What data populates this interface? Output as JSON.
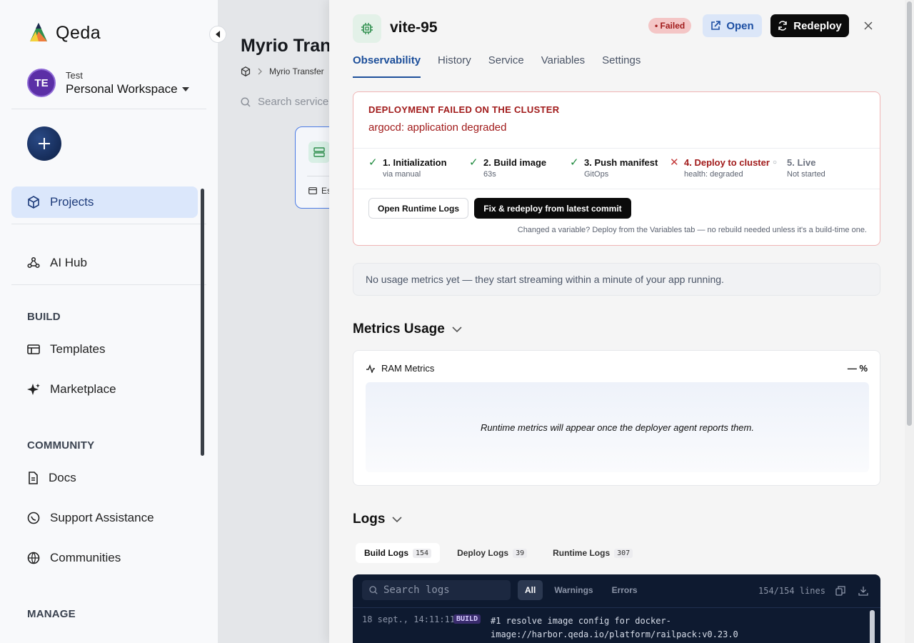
{
  "sidebar": {
    "brand": "Qeda",
    "workspace": {
      "initials": "TE",
      "label": "Test",
      "name": "Personal Workspace"
    },
    "items": [
      {
        "label": "Projects",
        "icon": "cube-icon"
      },
      {
        "label": "AI Hub",
        "icon": "ai-hub-icon"
      }
    ],
    "sections": {
      "build": {
        "title": "BUILD",
        "items": [
          {
            "label": "Templates"
          },
          {
            "label": "Marketplace"
          }
        ]
      },
      "community": {
        "title": "COMMUNITY",
        "items": [
          {
            "label": "Docs"
          },
          {
            "label": "Support Assistance"
          },
          {
            "label": "Communities"
          }
        ]
      },
      "manage": {
        "title": "MANAGE"
      }
    }
  },
  "background": {
    "project_title": "Myrio Trans",
    "breadcrumb": "Myrio Transfer",
    "search_placeholder": "Search service",
    "card_footer": "Es"
  },
  "panel": {
    "service_name": "vite-95",
    "status": "• Failed",
    "open_label": "Open",
    "redeploy_label": "Redeploy",
    "tabs": [
      "Observability",
      "History",
      "Service",
      "Variables",
      "Settings"
    ],
    "alert": {
      "title": "DEPLOYMENT FAILED ON THE CLUSTER",
      "message": "argocd: application degraded",
      "steps": [
        {
          "name": "1. Initialization",
          "sub": "via manual",
          "state": "ok"
        },
        {
          "name": "2. Build image",
          "sub": "63s",
          "state": "ok"
        },
        {
          "name": "3. Push manifest",
          "sub": "GitOps",
          "state": "ok"
        },
        {
          "name": "4. Deploy to cluster",
          "sub": "health: degraded",
          "state": "failed"
        },
        {
          "name": "5. Live",
          "sub": "Not started",
          "state": "pending"
        }
      ],
      "btn_logs": "Open Runtime Logs",
      "btn_fix": "Fix & redeploy from latest commit",
      "hint": "Changed a variable? Deploy from the Variables tab — no rebuild needed unless it's a build-time one."
    },
    "usage_note": "No usage metrics yet — they start streaming within a minute of your app running.",
    "metrics": {
      "heading": "Metrics Usage",
      "card_title": "RAM Metrics",
      "value": "— %",
      "empty": "Runtime metrics will appear once the deployer agent reports them."
    },
    "logs": {
      "heading": "Logs",
      "tabs": [
        {
          "label": "Build Logs",
          "count": "154"
        },
        {
          "label": "Deploy Logs",
          "count": "39"
        },
        {
          "label": "Runtime Logs",
          "count": "307"
        }
      ],
      "search_placeholder": "Search logs",
      "filters": [
        "All",
        "Warnings",
        "Errors"
      ],
      "line_count": "154/154 lines",
      "entries": [
        {
          "ts": "18 sept., 14:11:11",
          "tag": "BUILD",
          "msg": "#1 resolve image config for docker-image://harbor.qeda.io/platform/railpack:v0.23.0"
        }
      ]
    }
  },
  "colors": {
    "accent": "#1d4f9a",
    "danger": "#a11b1b",
    "success": "#1f8a3e"
  }
}
